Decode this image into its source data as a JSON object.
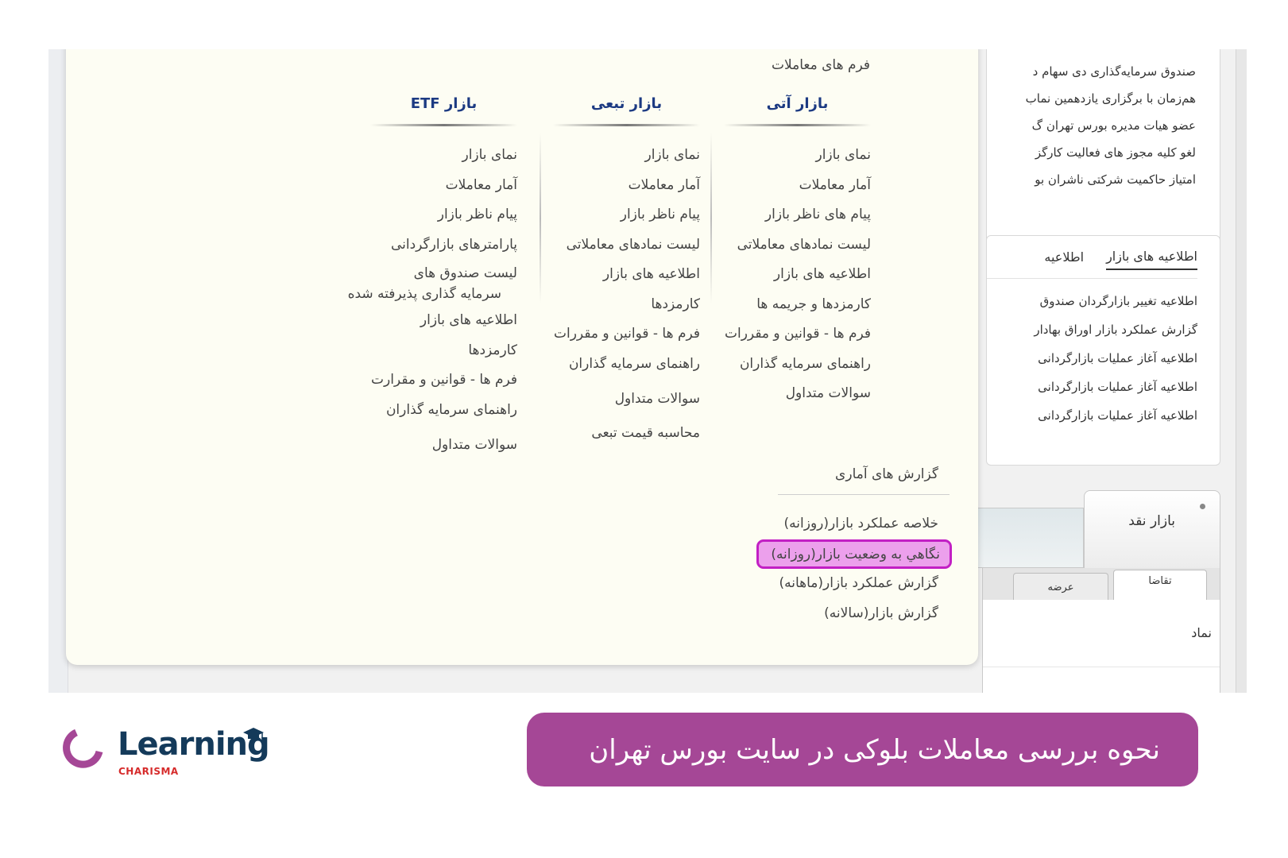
{
  "mega_menu": {
    "top_link": "فرم های معاملات",
    "columns": [
      {
        "title": "بازار آتی",
        "items": [
          "نمای بازار",
          "آمار معاملات",
          "پیام های ناظر بازار",
          "لیست نمادهای معاملاتی",
          "اطلاعیه های بازار",
          "کارمزدها و جریمه ها",
          "فرم ها - قوانین و مقررات",
          "راهنمای سرمایه گذاران",
          "سوالات متداول"
        ]
      },
      {
        "title": "بازار تبعی",
        "items": [
          "نمای بازار",
          "آمار معاملات",
          "پیام ناظر بازار",
          "لیست نمادهای معاملاتی",
          "اطلاعیه های بازار",
          "کارمزدها",
          "فرم ها - قوانین و مقررات",
          "راهنمای سرمایه گذاران",
          "سوالات متداول",
          "محاسبه قیمت تبعی"
        ]
      },
      {
        "title": "بازار ETF",
        "items": [
          "نمای بازار",
          "آمار معاملات",
          "پیام ناظر بازار",
          "پارامترهای بازارگردانی",
          "لیست صندوق های",
          "سرمایه گذاری پذیرفته شده",
          "اطلاعیه های بازار",
          "کارمزدها",
          "فرم ها - قوانین و مقرارت",
          "راهنمای سرمایه گذاران",
          "سوالات متداول"
        ]
      }
    ],
    "stats": {
      "title": "گزارش های آماری",
      "items": [
        "خلاصه عملکرد بازار(روزانه)",
        "نگاهي به وضعیت بازار(روزانه)",
        "گزارش عملکرد بازار(ماهانه)",
        "گزارش بازار(سالانه)"
      ],
      "highlighted_index": 1
    }
  },
  "news": {
    "lines": [
      "صندوق سرمایه‌گذاری دی سهام د",
      "هم‌زمان با برگزاری یازدهمین نماب",
      "عضو هیات مدیره بورس تهران گ",
      "لغو کلیه مجوز های فعالیت کارگز",
      "امتیاز حاکمیت شرکتی ناشران بو"
    ]
  },
  "announcements": {
    "tabs": [
      "اطلاعیه های بازار",
      "اطلاعیه"
    ],
    "active_tab": 0,
    "items": [
      "اطلاعیه تغییر بازارگردان صندوق",
      "گزارش عملکرد بازار اوراق بهادار",
      "اطلاعیه آغاز عملیات بازارگردانی",
      "اطلاعیه آغاز عملیات بازارگردانی",
      "اطلاعیه آغاز عملیات بازارگردانی"
    ]
  },
  "market_widget": {
    "main_tab": "بازار نقد",
    "sub_tabs": {
      "bid": "تقاضا",
      "ask": "عرضه"
    },
    "column_header": "نماد"
  },
  "banner": {
    "title": "نحوه بررسی معاملات بلوکی در سایت بورس تهران",
    "color": "#a54796"
  },
  "logo": {
    "word": "Learning",
    "sub": "CHARISMA",
    "ring_color": "#a54796",
    "word_color": "#143a5a",
    "sub_color": "#d62b2b"
  },
  "colors": {
    "menu_bg": "#fdfdf3",
    "column_title": "#1c3a82",
    "highlight_fill": "#eca0ec",
    "highlight_border": "#c21fc4"
  }
}
